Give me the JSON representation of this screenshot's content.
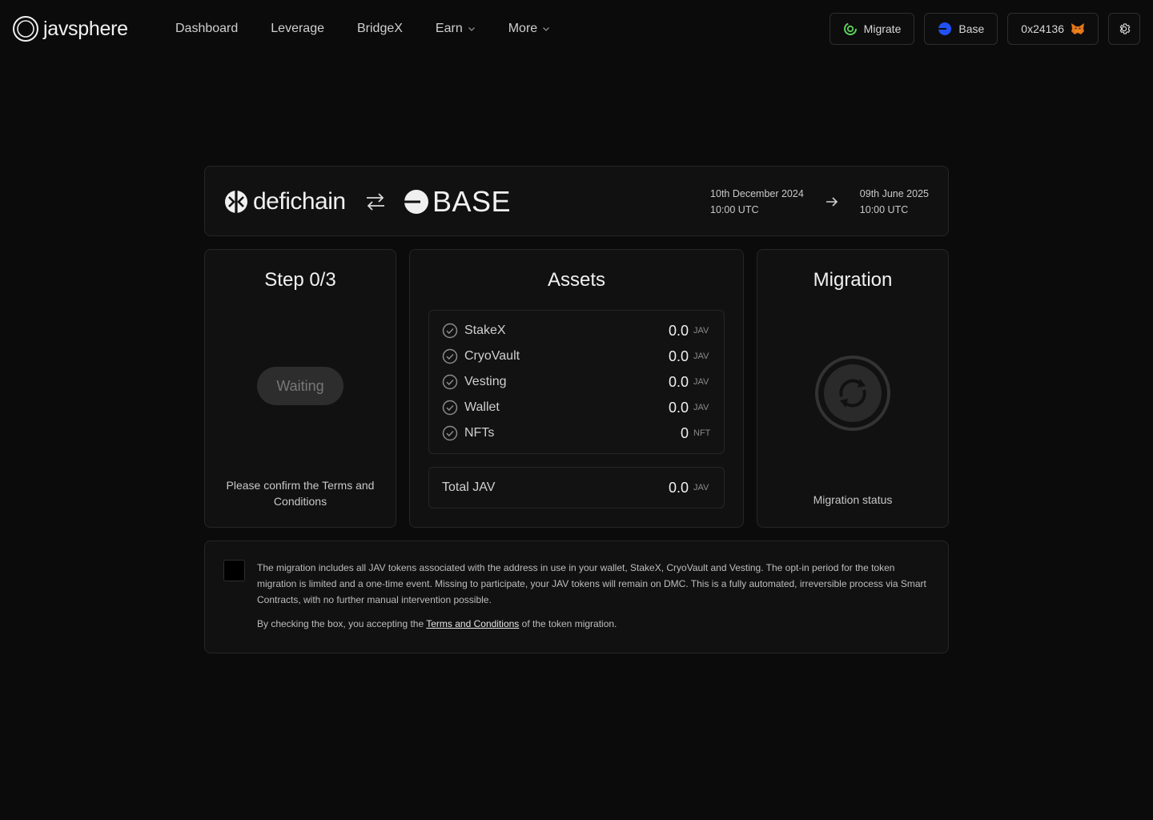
{
  "header": {
    "logo_text": "javsphere",
    "nav": [
      {
        "label": "Dashboard"
      },
      {
        "label": "Leverage"
      },
      {
        "label": "BridgeX"
      },
      {
        "label": "Earn"
      },
      {
        "label": "More"
      }
    ],
    "migrate_label": "Migrate",
    "network_label": "Base",
    "address_label": "0x24136",
    "icons": {
      "migrate": "migrate-icon",
      "network": "base-icon",
      "wallet": "metamask-fox-icon",
      "settings": "gear-icon"
    }
  },
  "banner": {
    "from_chain": "defichain",
    "to_chain": "BASE",
    "start_date": "10th December 2024",
    "start_time": "10:00 UTC",
    "end_date": "09th June 2025",
    "end_time": "10:00 UTC"
  },
  "step": {
    "title": "Step 0/3",
    "button_label": "Waiting",
    "note": "Please confirm the Terms and Conditions"
  },
  "assets": {
    "title": "Assets",
    "items": [
      {
        "name": "StakeX",
        "value": "0.0",
        "unit": "JAV"
      },
      {
        "name": "CryoVault",
        "value": "0.0",
        "unit": "JAV"
      },
      {
        "name": "Vesting",
        "value": "0.0",
        "unit": "JAV"
      },
      {
        "name": "Wallet",
        "value": "0.0",
        "unit": "JAV"
      },
      {
        "name": "NFTs",
        "value": "0",
        "unit": "NFT"
      }
    ],
    "total_label": "Total JAV",
    "total_value": "0.0",
    "total_unit": "JAV"
  },
  "migration": {
    "title": "Migration",
    "status_label": "Migration status"
  },
  "terms": {
    "body": "The migration includes all JAV tokens associated with the address in use in your wallet, StakeX, CryoVault and Vesting. The opt-in period for the token migration is limited and a one-time event. Missing to participate, your JAV tokens will remain on DMC. This is a fully automated, irreversible process via Smart Contracts, with no further manual intervention possible.",
    "accept_prefix": "By checking the box, you accepting the ",
    "accept_link": "Terms and Conditions",
    "accept_suffix": " of the token migration."
  },
  "colors": {
    "background": "#0b0b0b",
    "card": "#111111",
    "border": "#262626",
    "base_blue": "#2151f5",
    "migrate_green": "#5fd35f"
  }
}
